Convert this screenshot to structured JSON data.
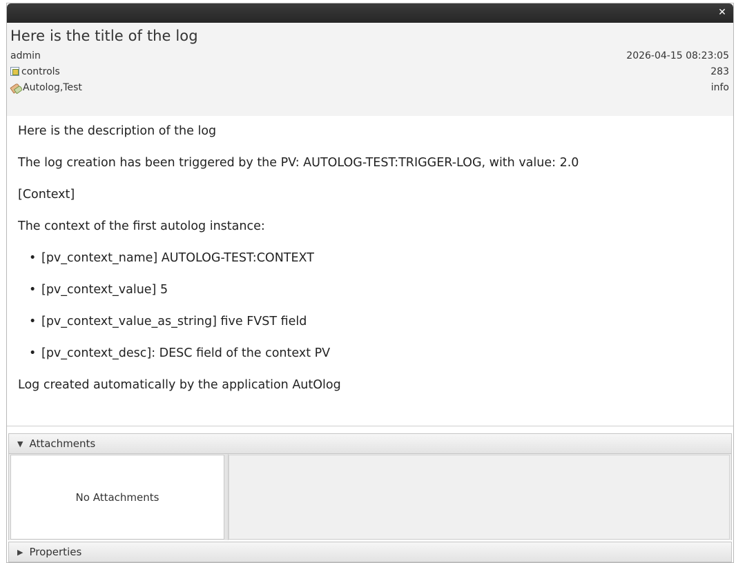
{
  "window": {
    "close_glyph": "✕"
  },
  "log": {
    "title": "Here is the title of the log",
    "author": "admin",
    "date": "2026-04-15 08:23:05",
    "logbook": "controls",
    "log_id": "283",
    "tags": "Autolog,Test",
    "level": "info",
    "description": {
      "line1": "Here is the description of the log",
      "line2": "The log creation has been triggered by the PV: AUTOLOG-TEST:TRIGGER-LOG, with value: 2.0",
      "line3": "[Context]",
      "line4": "The context of the first autolog instance:",
      "items": [
        "[pv_context_name] AUTOLOG-TEST:CONTEXT",
        "[pv_context_value] 5",
        "[pv_context_value_as_string] five FVST field",
        "[pv_context_desc]: DESC field of the context PV"
      ],
      "footer": "Log created automatically by the application AutOlog"
    }
  },
  "attachments": {
    "header_label": "Attachments",
    "empty_text": "No Attachments",
    "expanded_glyph": "▼"
  },
  "properties": {
    "header_label": "Properties",
    "collapsed_glyph": "▶"
  },
  "icons": {
    "logbook": "logbook-icon",
    "tags": "tag-icon",
    "close": "close-icon"
  }
}
